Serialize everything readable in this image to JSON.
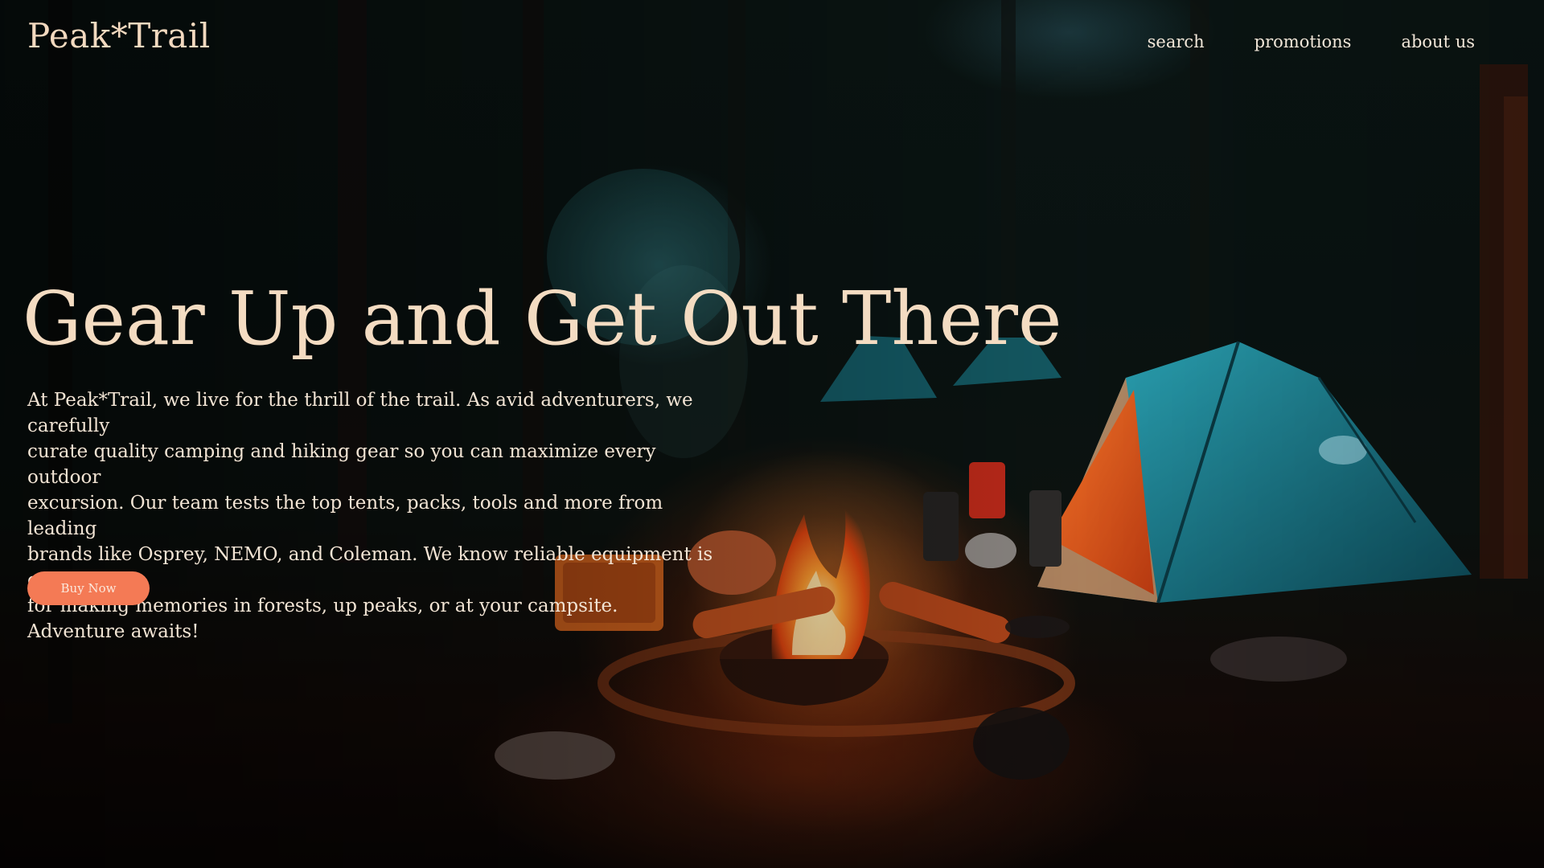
{
  "brand": {
    "logo": "Peak*Trail"
  },
  "nav": {
    "items": [
      {
        "label": "search"
      },
      {
        "label": "promotions"
      },
      {
        "label": "about us"
      }
    ]
  },
  "hero": {
    "title": "Gear Up and Get Out There",
    "paragraph_lines": [
      "At Peak*Trail, we live for the thrill of the trail. As avid adventurers, we carefully",
      "curate quality camping and hiking gear so you can maximize every outdoor",
      "excursion. Our team tests the top tents, packs, tools and more from leading",
      "brands like Osprey, NEMO, and Coleman. We know reliable equipment is crucial",
      "for making memories in forests, up peaks, or at your campsite.",
      "Adventure awaits!"
    ],
    "cta_label": "Buy Now"
  },
  "colors": {
    "accent_button": "#f47a55",
    "heading_text": "#f4dcc2",
    "body_text": "#f2e4d4"
  }
}
